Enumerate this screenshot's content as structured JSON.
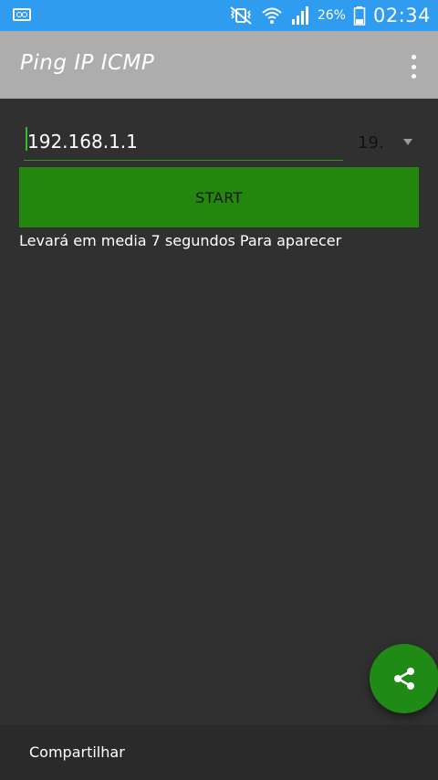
{
  "status_bar": {
    "battery_percent": "26%",
    "time": "02:34",
    "color": "#2f9cef"
  },
  "app_bar": {
    "title": "Ping IP ICMP",
    "background": "#adadad"
  },
  "form": {
    "ip_value": "192.168.1.1",
    "select_value": "19.",
    "start_label": "START",
    "accent": "#22860f"
  },
  "hint_text": "Levará em media 7 segundos Para aparecer",
  "fab": {
    "icon": "share-icon"
  },
  "bottom_bar": {
    "share_label": "Compartilhar"
  }
}
